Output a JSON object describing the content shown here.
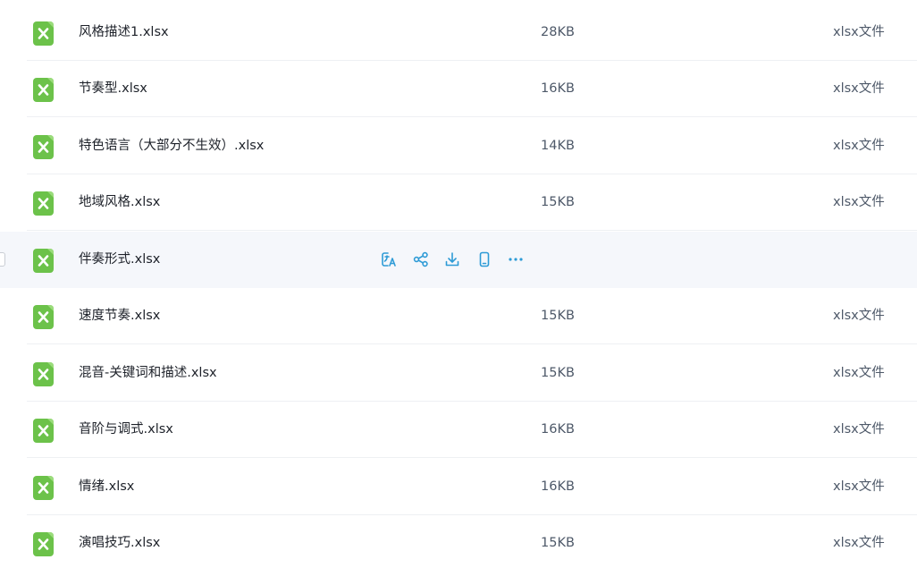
{
  "files": [
    {
      "name": "风格描述1.xlsx",
      "size": "28KB",
      "type": "xlsx文件",
      "icon": "xlsx-file-icon",
      "hovered": false
    },
    {
      "name": "节奏型.xlsx",
      "size": "16KB",
      "type": "xlsx文件",
      "icon": "xlsx-file-icon",
      "hovered": false
    },
    {
      "name": "特色语言（大部分不生效）.xlsx",
      "size": "14KB",
      "type": "xlsx文件",
      "icon": "xlsx-file-icon",
      "hovered": false
    },
    {
      "name": "地域风格.xlsx",
      "size": "15KB",
      "type": "xlsx文件",
      "icon": "xlsx-file-icon",
      "hovered": false
    },
    {
      "name": "伴奏形式.xlsx",
      "size": "",
      "type": "",
      "icon": "xlsx-file-icon",
      "hovered": true
    },
    {
      "name": "速度节奏.xlsx",
      "size": "15KB",
      "type": "xlsx文件",
      "icon": "xlsx-file-icon",
      "hovered": false
    },
    {
      "name": "混音-关键词和描述.xlsx",
      "size": "15KB",
      "type": "xlsx文件",
      "icon": "xlsx-file-icon",
      "hovered": false
    },
    {
      "name": "音阶与调式.xlsx",
      "size": "16KB",
      "type": "xlsx文件",
      "icon": "xlsx-file-icon",
      "hovered": false
    },
    {
      "name": "情绪.xlsx",
      "size": "16KB",
      "type": "xlsx文件",
      "icon": "xlsx-file-icon",
      "hovered": false
    },
    {
      "name": "演唱技巧.xlsx",
      "size": "15KB",
      "type": "xlsx文件",
      "icon": "xlsx-file-icon",
      "hovered": false
    }
  ],
  "row_actions": [
    "translate-icon",
    "share-icon",
    "download-icon",
    "mobile-icon",
    "more-icon"
  ],
  "colors": {
    "accent": "#2e9bd6",
    "excel_green": "#6cc24a",
    "hover_bg": "#f5f7fb",
    "separator": "#eef0f3"
  }
}
